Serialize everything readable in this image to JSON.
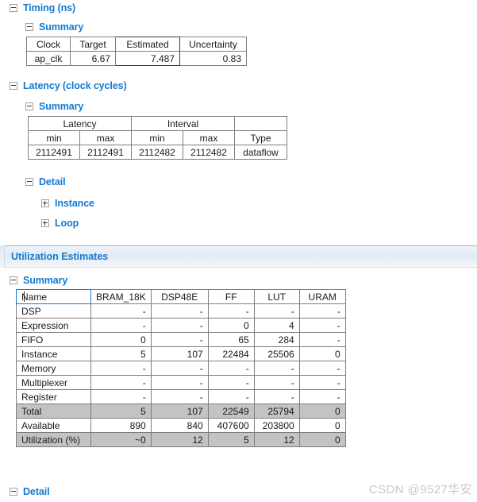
{
  "timing": {
    "section_label": "Timing (ns)",
    "summary_label": "Summary",
    "headers": [
      "Clock",
      "Target",
      "Estimated",
      "Uncertainty"
    ],
    "rows": [
      {
        "clock": "ap_clk",
        "target": "6.67",
        "estimated": "7.487",
        "uncertainty": "0.83"
      }
    ]
  },
  "latency": {
    "section_label": "Latency (clock cycles)",
    "summary_label": "Summary",
    "group_headers": [
      "Latency",
      "Interval",
      ""
    ],
    "sub_headers": [
      "min",
      "max",
      "min",
      "max",
      "Type"
    ],
    "rows": [
      {
        "latency_min": "2112491",
        "latency_max": "2112491",
        "interval_min": "2112482",
        "interval_max": "2112482",
        "type": "dataflow"
      }
    ],
    "detail_label": "Detail",
    "detail_children": [
      "Instance",
      "Loop"
    ]
  },
  "utilization": {
    "banner_title": "Utilization Estimates",
    "summary_label": "Summary",
    "headers": [
      "Name",
      "BRAM_18K",
      "DSP48E",
      "FF",
      "LUT",
      "URAM"
    ],
    "rows": [
      {
        "name": "DSP",
        "values": [
          "-",
          "-",
          "-",
          "-",
          "-"
        ],
        "highlight": false
      },
      {
        "name": "Expression",
        "values": [
          "-",
          "-",
          "0",
          "4",
          "-"
        ],
        "highlight": false
      },
      {
        "name": "FIFO",
        "values": [
          "0",
          "-",
          "65",
          "284",
          "-"
        ],
        "highlight": false
      },
      {
        "name": "Instance",
        "values": [
          "5",
          "107",
          "22484",
          "25506",
          "0"
        ],
        "highlight": false
      },
      {
        "name": "Memory",
        "values": [
          "-",
          "-",
          "-",
          "-",
          "-"
        ],
        "highlight": false
      },
      {
        "name": "Multiplexer",
        "values": [
          "-",
          "-",
          "-",
          "-",
          "-"
        ],
        "highlight": false
      },
      {
        "name": "Register",
        "values": [
          "-",
          "-",
          "-",
          "-",
          "-"
        ],
        "highlight": false
      },
      {
        "name": "Total",
        "values": [
          "5",
          "107",
          "22549",
          "25794",
          "0"
        ],
        "highlight": true
      },
      {
        "name": "Available",
        "values": [
          "890",
          "840",
          "407600",
          "203800",
          "0"
        ],
        "highlight": false
      },
      {
        "name": "Utilization (%)",
        "values": [
          "~0",
          "12",
          "5",
          "12",
          "0"
        ],
        "highlight": true
      }
    ],
    "detail_label": "Detail"
  },
  "watermark": "CSDN @9527华安",
  "colors": {
    "link": "#1479d1",
    "error_value": "#ff0000",
    "table_border": "#7e7e7e",
    "highlight_row": "#c3c3c3",
    "banner_top_border": "#97b6d8"
  }
}
